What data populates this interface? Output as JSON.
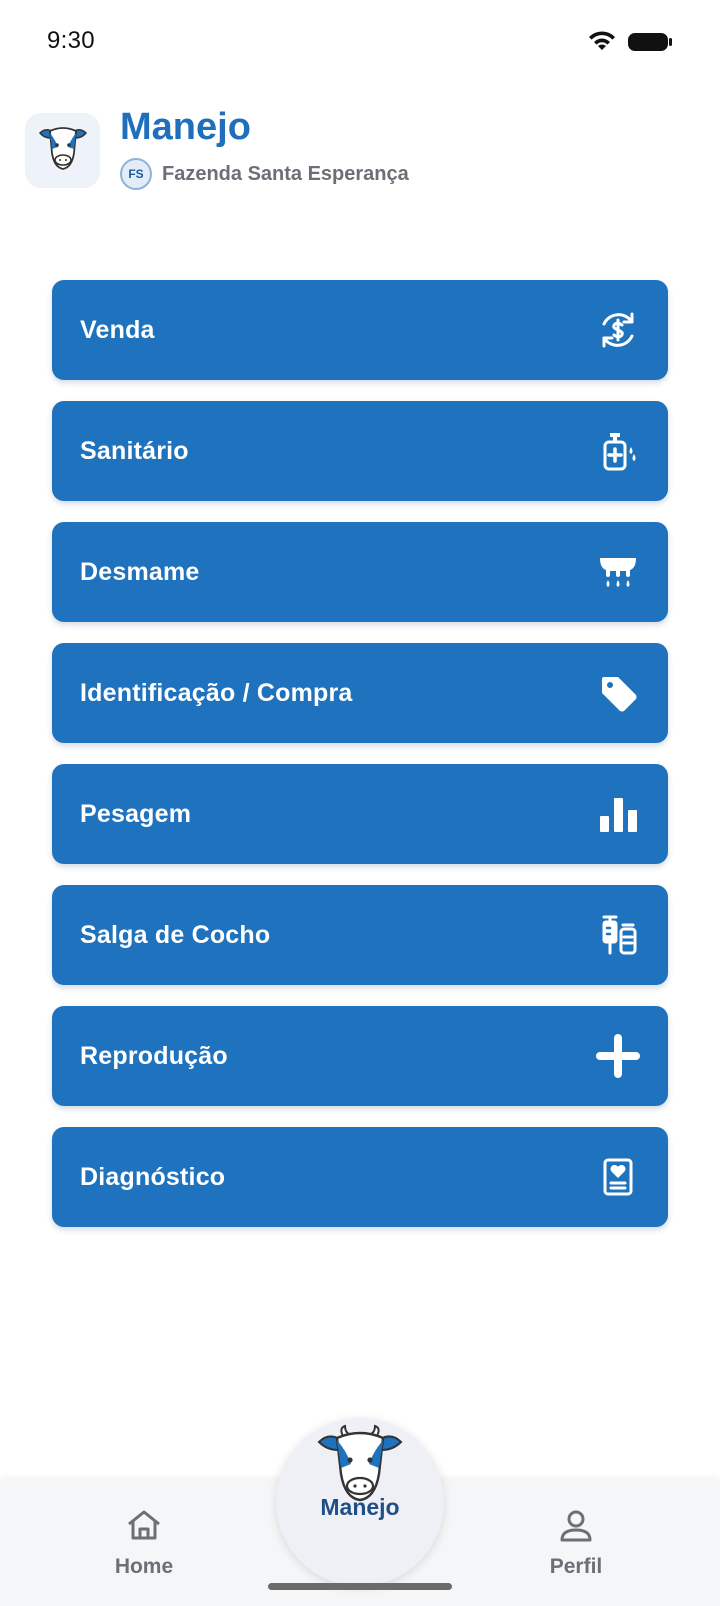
{
  "status_bar": {
    "time": "9:30",
    "wifi_icon": "wifi-icon",
    "battery_icon": "battery-icon"
  },
  "header": {
    "logo_icon": "cow-logo-icon",
    "title": "Manejo",
    "farm_initials": "FS",
    "farm_name": "Fazenda Santa Esperança"
  },
  "menu": {
    "items": [
      {
        "label": "Venda",
        "icon": "dollar-cycle-icon"
      },
      {
        "label": "Sanitário",
        "icon": "sanitizer-icon"
      },
      {
        "label": "Desmame",
        "icon": "udder-drops-icon"
      },
      {
        "label": "Identificação / Compra",
        "icon": "tag-icon"
      },
      {
        "label": "Pesagem",
        "icon": "bar-chart-icon"
      },
      {
        "label": "Salga de Cocho",
        "icon": "syringe-vial-icon"
      },
      {
        "label": "Reprodução",
        "icon": "plus-icon"
      },
      {
        "label": "Diagnóstico",
        "icon": "medical-report-icon"
      }
    ]
  },
  "bottom_nav": {
    "home_label": "Home",
    "center_label": "Manejo",
    "profile_label": "Perfil"
  },
  "colors": {
    "primary": "#1f72bd",
    "title": "#1f6fbd",
    "nav_active": "#1f4f86",
    "text_muted": "#6b6f76"
  }
}
